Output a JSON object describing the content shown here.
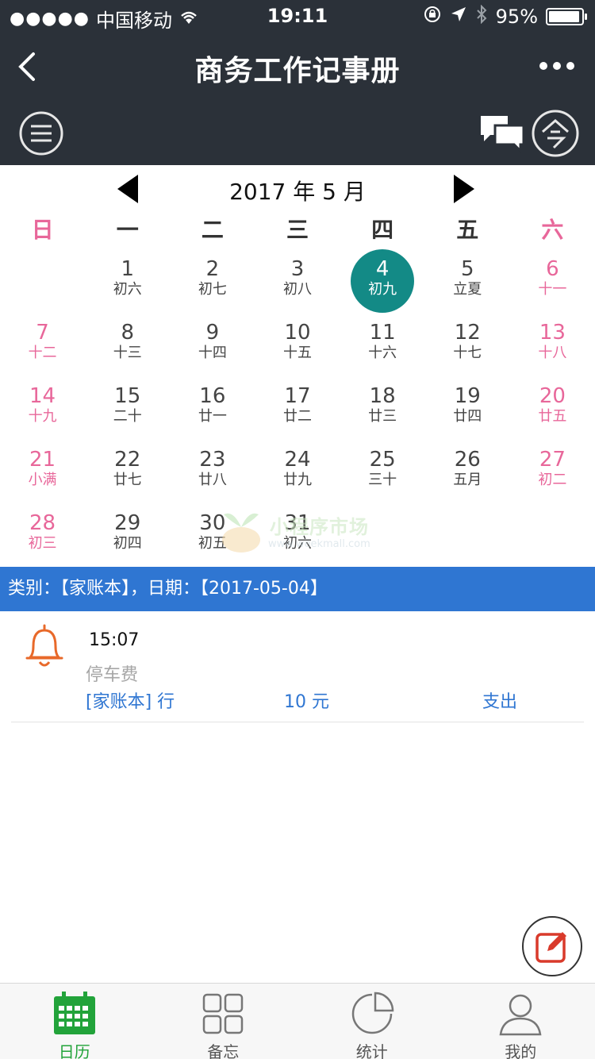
{
  "status_bar": {
    "carrier": "中国移动",
    "time": "19:11",
    "battery_percent": "95%",
    "battery_level": 0.95
  },
  "nav": {
    "title": "商务工作记事册"
  },
  "calendar": {
    "month_label": "2017 年 5 月",
    "weekdays": [
      "日",
      "一",
      "二",
      "三",
      "四",
      "五",
      "六"
    ],
    "selected_day": "4",
    "days": [
      {
        "num": "",
        "lunar": ""
      },
      {
        "num": "1",
        "lunar": "初六"
      },
      {
        "num": "2",
        "lunar": "初七"
      },
      {
        "num": "3",
        "lunar": "初八"
      },
      {
        "num": "4",
        "lunar": "初九"
      },
      {
        "num": "5",
        "lunar": "立夏"
      },
      {
        "num": "6",
        "lunar": "十一"
      },
      {
        "num": "7",
        "lunar": "十二"
      },
      {
        "num": "8",
        "lunar": "十三"
      },
      {
        "num": "9",
        "lunar": "十四"
      },
      {
        "num": "10",
        "lunar": "十五"
      },
      {
        "num": "11",
        "lunar": "十六"
      },
      {
        "num": "12",
        "lunar": "十七"
      },
      {
        "num": "13",
        "lunar": "十八"
      },
      {
        "num": "14",
        "lunar": "十九"
      },
      {
        "num": "15",
        "lunar": "二十"
      },
      {
        "num": "16",
        "lunar": "廿一"
      },
      {
        "num": "17",
        "lunar": "廿二"
      },
      {
        "num": "18",
        "lunar": "廿三"
      },
      {
        "num": "19",
        "lunar": "廿四"
      },
      {
        "num": "20",
        "lunar": "廿五"
      },
      {
        "num": "21",
        "lunar": "小满"
      },
      {
        "num": "22",
        "lunar": "廿七"
      },
      {
        "num": "23",
        "lunar": "廿八"
      },
      {
        "num": "24",
        "lunar": "廿九"
      },
      {
        "num": "25",
        "lunar": "三十"
      },
      {
        "num": "26",
        "lunar": "五月"
      },
      {
        "num": "27",
        "lunar": "初二"
      },
      {
        "num": "28",
        "lunar": "初三"
      },
      {
        "num": "29",
        "lunar": "初四"
      },
      {
        "num": "30",
        "lunar": "初五"
      },
      {
        "num": "31",
        "lunar": "初六"
      }
    ]
  },
  "watermark": {
    "text": "小程序市场",
    "url": "www.weekmall.com"
  },
  "info_bar": {
    "text": "类别：【家账本】，日期：【2017-05-04】"
  },
  "record": {
    "time": "15:07",
    "note": "停车费",
    "category": "[家账本] 行",
    "amount": "10 元",
    "type": "支出"
  },
  "tabs": [
    {
      "label": "日历",
      "icon": "calendar-icon",
      "active": true
    },
    {
      "label": "备忘",
      "icon": "grid-icon",
      "active": false
    },
    {
      "label": "统计",
      "icon": "pie-chart-icon",
      "active": false
    },
    {
      "label": "我的",
      "icon": "user-icon",
      "active": false
    }
  ],
  "colors": {
    "header_bg": "#2b3139",
    "weekend": "#e8679a",
    "selected": "#138a86",
    "info_bar": "#2f76d2",
    "active_tab": "#22a33a",
    "bell": "#e8692a",
    "fab_pencil": "#d93a2b"
  }
}
